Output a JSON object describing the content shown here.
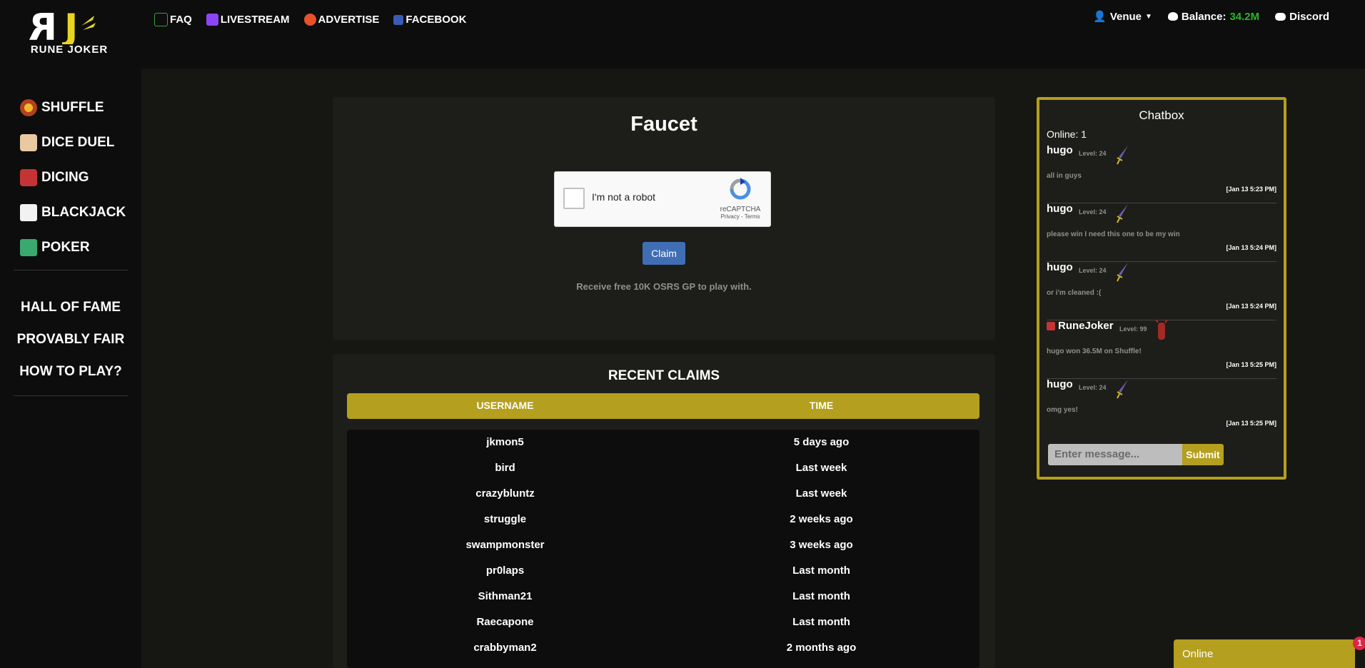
{
  "header": {
    "logo_text": "RUNE JOKER",
    "nav": [
      {
        "label": "FAQ",
        "icon": "faq-icon"
      },
      {
        "label": "LIVESTREAM",
        "icon": "twitch-icon"
      },
      {
        "label": "ADVERTISE",
        "icon": "advertise-icon"
      },
      {
        "label": "FACEBOOK",
        "icon": "facebook-icon"
      }
    ],
    "user": {
      "name": "Venue",
      "icon": "user-icon"
    },
    "balance": {
      "label": "Balance:",
      "value": "34.2M",
      "icon": "coin-icon"
    },
    "discord": {
      "label": "Discord",
      "icon": "discord-icon"
    }
  },
  "sidebar": {
    "games": [
      {
        "label": "SHUFFLE",
        "icon": "shuffle-icon"
      },
      {
        "label": "DICE DUEL",
        "icon": "dice-duel-icon"
      },
      {
        "label": "DICING",
        "icon": "dicing-icon"
      },
      {
        "label": "BLACKJACK",
        "icon": "blackjack-icon"
      },
      {
        "label": "POKER",
        "icon": "poker-icon"
      }
    ],
    "links": [
      "HALL OF FAME",
      "PROVABLY FAIR",
      "HOW TO PLAY?"
    ]
  },
  "faucet": {
    "title": "Faucet",
    "captcha": {
      "label": "I'm not a robot",
      "brand": "reCAPTCHA",
      "terms": "Privacy - Terms"
    },
    "claim_label": "Claim",
    "note": "Receive free 10K OSRS GP to play with."
  },
  "claims": {
    "title": "RECENT CLAIMS",
    "headers": [
      "USERNAME",
      "TIME"
    ],
    "rows": [
      [
        "jkmon5",
        "5 days ago"
      ],
      [
        "bird",
        "Last week"
      ],
      [
        "crazybluntz",
        "Last week"
      ],
      [
        "struggle",
        "2 weeks ago"
      ],
      [
        "swampmonster",
        "3 weeks ago"
      ],
      [
        "pr0laps",
        "Last month"
      ],
      [
        "Sithman21",
        "Last month"
      ],
      [
        "Raecapone",
        "Last month"
      ],
      [
        "crabbyman2",
        "2 months ago"
      ]
    ]
  },
  "chatbox": {
    "title": "Chatbox",
    "online": "Online: 1",
    "messages": [
      {
        "user": "hugo",
        "level": "Level: 24",
        "text": "all in guys",
        "time": "[Jan 13 5:23 PM]"
      },
      {
        "user": "hugo",
        "level": "Level: 24",
        "text": "please win I need this one to be my win",
        "time": "[Jan 13 5:24 PM]"
      },
      {
        "user": "hugo",
        "level": "Level: 24",
        "text": "or i'm cleaned :(",
        "time": "[Jan 13 5:24 PM]"
      },
      {
        "user": "RuneJoker",
        "level": "Level: 99",
        "text": "hugo won 36.5M on Shuffle!",
        "time": "[Jan 13 5:25 PM]"
      },
      {
        "user": "hugo",
        "level": "Level: 24",
        "text": "omg yes!",
        "time": "[Jan 13 5:25 PM]"
      }
    ],
    "input_placeholder": "Enter message...",
    "submit_label": "Submit"
  },
  "online_widget": {
    "label": "Online",
    "badge": "1"
  },
  "colors": {
    "accent": "#b49f1e",
    "balance": "#2ab52a",
    "claim_button": "#3f6eb5",
    "background": "#0f0f0f"
  }
}
